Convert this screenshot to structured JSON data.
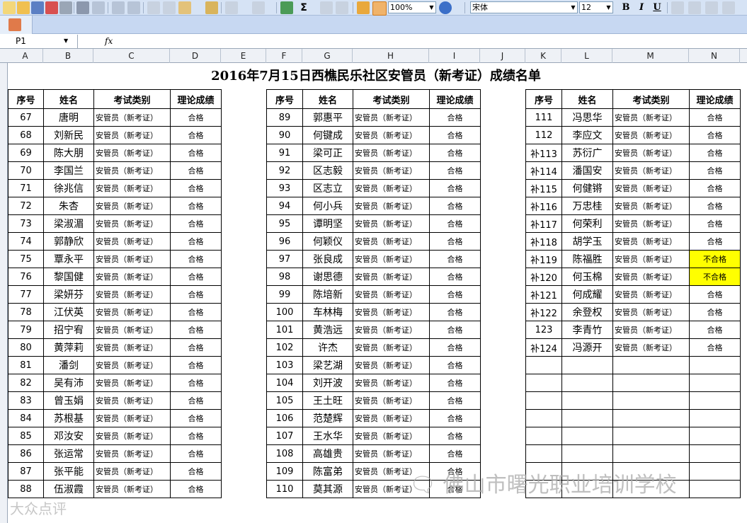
{
  "toolbar": {
    "zoom": "100%",
    "font_name": "宋体",
    "font_size": "12",
    "bold_label": "B",
    "italic_label": "I",
    "underline_label": "U",
    "sum_label": "Σ"
  },
  "formula_bar": {
    "name_box": "P1",
    "fx_label": "fx"
  },
  "columns": [
    "A",
    "B",
    "C",
    "D",
    "E",
    "F",
    "G",
    "H",
    "I",
    "J",
    "K",
    "L",
    "M",
    "N"
  ],
  "sheet": {
    "title": "2016年7月15日西樵民乐社区安管员（新考证）成绩名单",
    "headers": [
      "序号",
      "姓名",
      "考试类别",
      "理论成绩"
    ],
    "block1": [
      [
        "67",
        "唐明",
        "安管员（新考证）",
        "合格"
      ],
      [
        "68",
        "刘新民",
        "安管员（新考证）",
        "合格"
      ],
      [
        "69",
        "陈大朋",
        "安管员（新考证）",
        "合格"
      ],
      [
        "70",
        "李国兰",
        "安管员（新考证）",
        "合格"
      ],
      [
        "71",
        "徐兆信",
        "安管员（新考证）",
        "合格"
      ],
      [
        "72",
        "朱杏",
        "安管员（新考证）",
        "合格"
      ],
      [
        "73",
        "梁淑湄",
        "安管员（新考证）",
        "合格"
      ],
      [
        "74",
        "郭静欣",
        "安管员（新考证）",
        "合格"
      ],
      [
        "75",
        "覃永平",
        "安管员（新考证）",
        "合格"
      ],
      [
        "76",
        "黎国健",
        "安管员（新考证）",
        "合格"
      ],
      [
        "77",
        "梁妍芬",
        "安管员（新考证）",
        "合格"
      ],
      [
        "78",
        "江伏英",
        "安管员（新考证）",
        "合格"
      ],
      [
        "79",
        "招宁宥",
        "安管员（新考证）",
        "合格"
      ],
      [
        "80",
        "黄萍莉",
        "安管员（新考证）",
        "合格"
      ],
      [
        "81",
        "潘剑",
        "安管员（新考证）",
        "合格"
      ],
      [
        "82",
        "吴有沛",
        "安管员（新考证）",
        "合格"
      ],
      [
        "83",
        "曾玉娟",
        "安管员（新考证）",
        "合格"
      ],
      [
        "84",
        "苏根基",
        "安管员（新考证）",
        "合格"
      ],
      [
        "85",
        "邓汝安",
        "安管员（新考证）",
        "合格"
      ],
      [
        "86",
        "张运常",
        "安管员（新考证）",
        "合格"
      ],
      [
        "87",
        "张平能",
        "安管员（新考证）",
        "合格"
      ],
      [
        "88",
        "伍淑霞",
        "安管员（新考证）",
        "合格"
      ]
    ],
    "block2": [
      [
        "89",
        "郭惠平",
        "安管员（新考证）",
        "合格"
      ],
      [
        "90",
        "何键成",
        "安管员（新考证）",
        "合格"
      ],
      [
        "91",
        "梁可正",
        "安管员（新考证）",
        "合格"
      ],
      [
        "92",
        "区志毅",
        "安管员（新考证）",
        "合格"
      ],
      [
        "93",
        "区志立",
        "安管员（新考证）",
        "合格"
      ],
      [
        "94",
        "何小兵",
        "安管员（新考证）",
        "合格"
      ],
      [
        "95",
        "谭明坚",
        "安管员（新考证）",
        "合格"
      ],
      [
        "96",
        "何颖仪",
        "安管员（新考证）",
        "合格"
      ],
      [
        "97",
        "张良成",
        "安管员（新考证）",
        "合格"
      ],
      [
        "98",
        "谢思德",
        "安管员（新考证）",
        "合格"
      ],
      [
        "99",
        "陈培新",
        "安管员（新考证）",
        "合格"
      ],
      [
        "100",
        "车林梅",
        "安管员（新考证）",
        "合格"
      ],
      [
        "101",
        "黄浩远",
        "安管员（新考证）",
        "合格"
      ],
      [
        "102",
        "许杰",
        "安管员（新考证）",
        "合格"
      ],
      [
        "103",
        "梁艺湖",
        "安管员（新考证）",
        "合格"
      ],
      [
        "104",
        "刘开波",
        "安管员（新考证）",
        "合格"
      ],
      [
        "105",
        "王土旺",
        "安管员（新考证）",
        "合格"
      ],
      [
        "106",
        "范楚辉",
        "安管员（新考证）",
        "合格"
      ],
      [
        "107",
        "王水华",
        "安管员（新考证）",
        "合格"
      ],
      [
        "108",
        "高雄贵",
        "安管员（新考证）",
        "合格"
      ],
      [
        "109",
        "陈富弟",
        "安管员（新考证）",
        "合格"
      ],
      [
        "110",
        "莫其源",
        "安管员（新考证）",
        "合格"
      ]
    ],
    "block3": [
      [
        "111",
        "冯思华",
        "安管员（新考证）",
        "合格"
      ],
      [
        "112",
        "李应文",
        "安管员（新考证）",
        "合格"
      ],
      [
        "补113",
        "苏衍广",
        "安管员（新考证）",
        "合格"
      ],
      [
        "补114",
        "潘国安",
        "安管员（新考证）",
        "合格"
      ],
      [
        "补115",
        "何健锵",
        "安管员（新考证）",
        "合格"
      ],
      [
        "补116",
        "万忠桂",
        "安管员（新考证）",
        "合格"
      ],
      [
        "补117",
        "何荣利",
        "安管员（新考证）",
        "合格"
      ],
      [
        "补118",
        "胡学玉",
        "安管员（新考证）",
        "合格"
      ],
      [
        "补119",
        "陈福胜",
        "安管员（新考证）",
        "不合格"
      ],
      [
        "补120",
        "何玉棉",
        "安管员（新考证）",
        "不合格"
      ],
      [
        "补121",
        "何成耀",
        "安管员（新考证）",
        "合格"
      ],
      [
        "补122",
        "余登权",
        "安管员（新考证）",
        "合格"
      ],
      [
        "123",
        "李青竹",
        "安管员（新考证）",
        "合格"
      ],
      [
        "补124",
        "冯源开",
        "安管员（新考证）",
        "合格"
      ]
    ],
    "fail_highlight_color": "#ffff00"
  },
  "watermark": {
    "text": "佛山市曙光职业培训学校",
    "corner_text": "大众点评"
  }
}
